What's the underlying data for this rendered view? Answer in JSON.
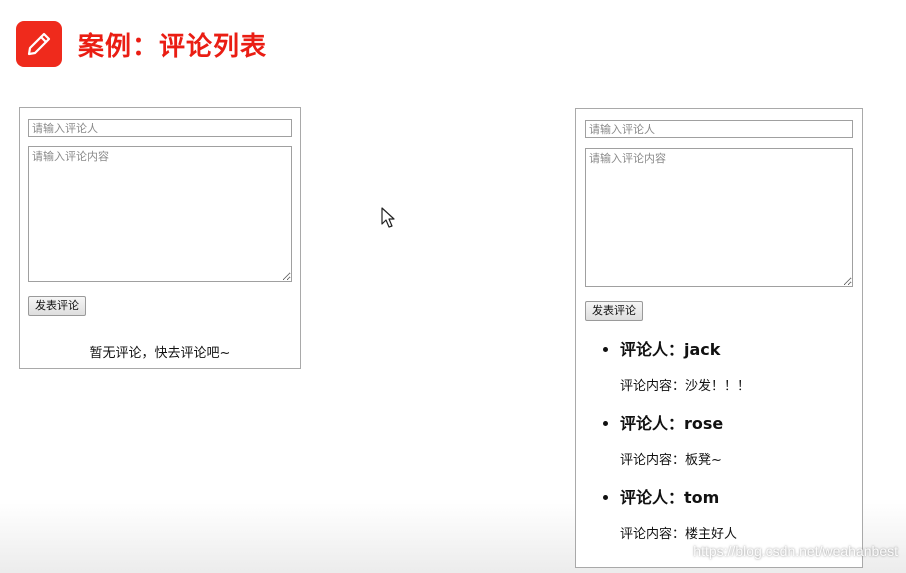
{
  "header": {
    "title": "案例：评论列表",
    "icon": "pencil-icon",
    "accent_color": "#ea1d13"
  },
  "empty_panel": {
    "commenter_placeholder": "请输入评论人",
    "content_placeholder": "请输入评论内容",
    "submit_label": "发表评论",
    "empty_message": "暂无评论，快去评论吧~"
  },
  "list_panel": {
    "commenter_placeholder": "请输入评论人",
    "content_placeholder": "请输入评论内容",
    "submit_label": "发表评论",
    "comments": [
      {
        "user": "评论人：jack",
        "content": "评论内容：沙发！！！"
      },
      {
        "user": "评论人：rose",
        "content": "评论内容：板凳~"
      },
      {
        "user": "评论人：tom",
        "content": "评论内容：楼主好人"
      }
    ]
  },
  "watermark": "https://blog.csdn.net/weahanbest"
}
